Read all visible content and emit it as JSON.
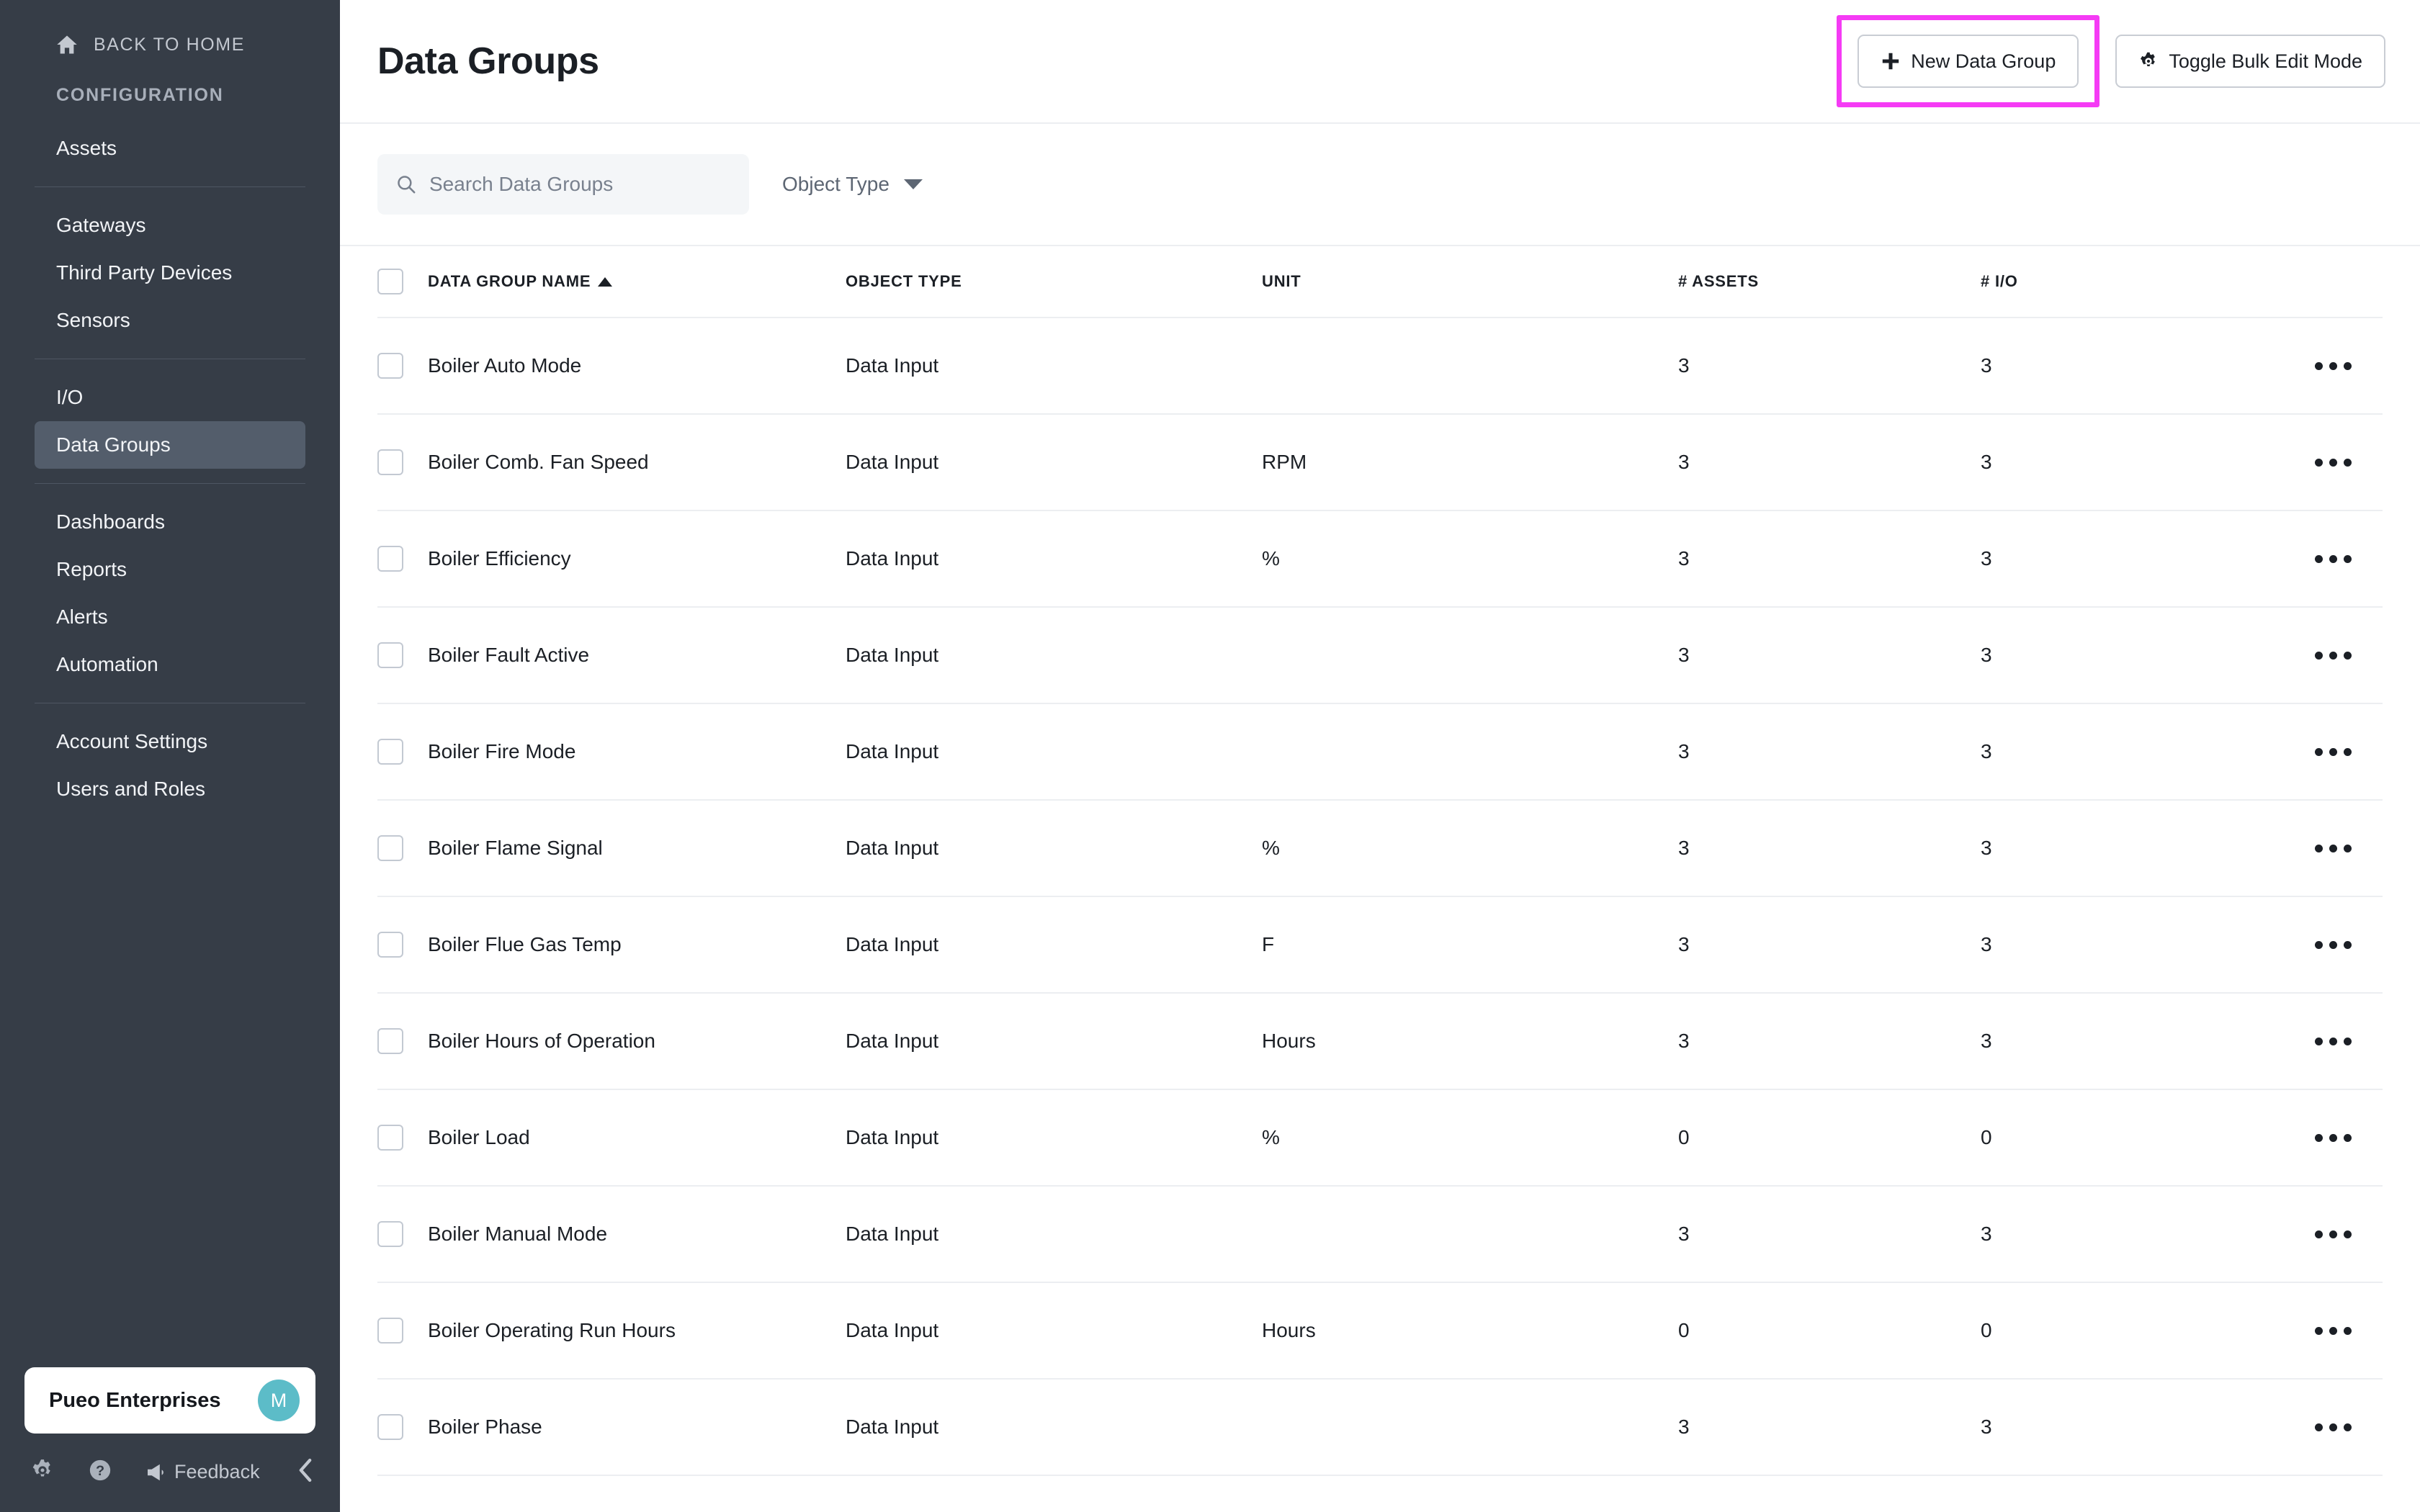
{
  "sidebar": {
    "back_home": {
      "label": "BACK TO HOME",
      "icon": "home-icon"
    },
    "section_title": "CONFIGURATION",
    "groups": [
      {
        "items": [
          {
            "label": "Assets",
            "active": false
          }
        ]
      },
      {
        "items": [
          {
            "label": "Gateways",
            "active": false
          },
          {
            "label": "Third Party Devices",
            "active": false
          },
          {
            "label": "Sensors",
            "active": false
          }
        ]
      },
      {
        "items": [
          {
            "label": "I/O",
            "active": false
          },
          {
            "label": "Data Groups",
            "active": true
          }
        ]
      },
      {
        "items": [
          {
            "label": "Dashboards",
            "active": false
          },
          {
            "label": "Reports",
            "active": false
          },
          {
            "label": "Alerts",
            "active": false
          },
          {
            "label": "Automation",
            "active": false
          }
        ]
      },
      {
        "items": [
          {
            "label": "Account Settings",
            "active": false
          },
          {
            "label": "Users and Roles",
            "active": false
          }
        ]
      }
    ],
    "org": {
      "name": "Pueo Enterprises",
      "avatar_initial": "M",
      "avatar_color": "#5cbcc8"
    },
    "bottom_bar": {
      "settings_icon": "gear-icon",
      "help_icon": "question-circle-icon",
      "feedback_label": "Feedback",
      "feedback_icon": "megaphone-icon",
      "collapse_icon": "chevron-left-icon"
    }
  },
  "header": {
    "title": "Data Groups",
    "new_button": {
      "label": "New Data Group",
      "icon": "plus-icon",
      "highlighted": true
    },
    "bulk_button": {
      "label": "Toggle Bulk Edit Mode",
      "icon": "gear-icon"
    },
    "highlight_color": "#f53bf5"
  },
  "toolbar": {
    "search": {
      "placeholder": "Search Data Groups",
      "value": "",
      "icon": "search-icon"
    },
    "object_type_filter": {
      "label": "Object Type",
      "icon": "chevron-down-icon"
    }
  },
  "table": {
    "columns": [
      {
        "key": "name",
        "label": "DATA GROUP NAME",
        "sort": "asc"
      },
      {
        "key": "type",
        "label": "OBJECT TYPE",
        "sort": ""
      },
      {
        "key": "unit",
        "label": "UNIT",
        "sort": ""
      },
      {
        "key": "assets",
        "label": "# ASSETS",
        "sort": ""
      },
      {
        "key": "io",
        "label": "# I/O",
        "sort": ""
      }
    ],
    "select_all_checked": false,
    "row_action_icon": "ellipsis-icon",
    "rows": [
      {
        "name": "Boiler Auto Mode",
        "type": "Data Input",
        "unit": "",
        "assets": "3",
        "io": "3",
        "checked": false
      },
      {
        "name": "Boiler Comb. Fan Speed",
        "type": "Data Input",
        "unit": "RPM",
        "assets": "3",
        "io": "3",
        "checked": false
      },
      {
        "name": "Boiler Efficiency",
        "type": "Data Input",
        "unit": "%",
        "assets": "3",
        "io": "3",
        "checked": false
      },
      {
        "name": "Boiler Fault Active",
        "type": "Data Input",
        "unit": "",
        "assets": "3",
        "io": "3",
        "checked": false
      },
      {
        "name": "Boiler Fire Mode",
        "type": "Data Input",
        "unit": "",
        "assets": "3",
        "io": "3",
        "checked": false
      },
      {
        "name": "Boiler Flame Signal",
        "type": "Data Input",
        "unit": "%",
        "assets": "3",
        "io": "3",
        "checked": false
      },
      {
        "name": "Boiler Flue Gas Temp",
        "type": "Data Input",
        "unit": "F",
        "assets": "3",
        "io": "3",
        "checked": false
      },
      {
        "name": "Boiler Hours of Operation",
        "type": "Data Input",
        "unit": "Hours",
        "assets": "3",
        "io": "3",
        "checked": false
      },
      {
        "name": "Boiler Load",
        "type": "Data Input",
        "unit": "%",
        "assets": "0",
        "io": "0",
        "checked": false
      },
      {
        "name": "Boiler Manual Mode",
        "type": "Data Input",
        "unit": "",
        "assets": "3",
        "io": "3",
        "checked": false
      },
      {
        "name": "Boiler Operating Run Hours",
        "type": "Data Input",
        "unit": "Hours",
        "assets": "0",
        "io": "0",
        "checked": false
      },
      {
        "name": "Boiler Phase",
        "type": "Data Input",
        "unit": "",
        "assets": "3",
        "io": "3",
        "checked": false
      }
    ]
  }
}
